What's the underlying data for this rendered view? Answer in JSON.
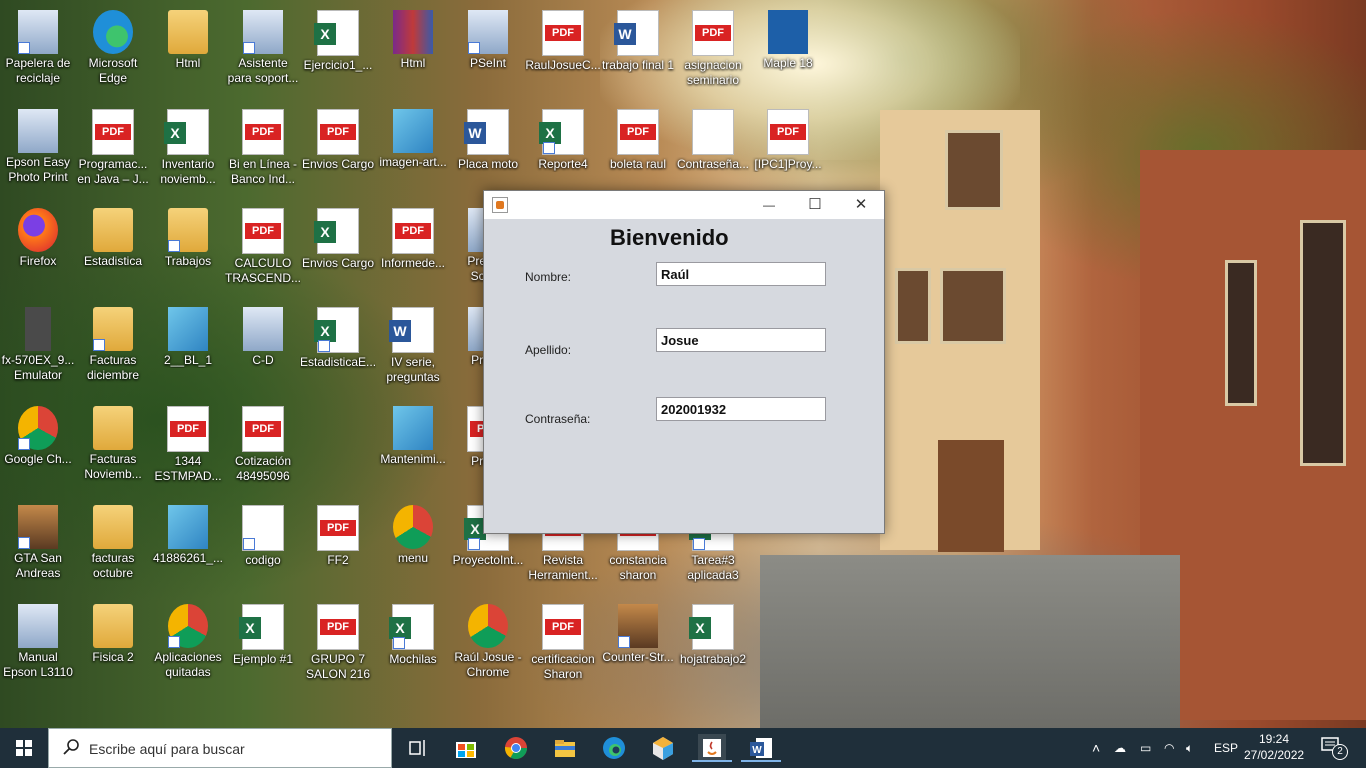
{
  "desktop_icons": [
    {
      "label": "Papelera de reciclaje",
      "type": "recycle-bin",
      "col": 0,
      "row": 0
    },
    {
      "label": "Microsoft Edge",
      "type": "edge",
      "col": 1,
      "row": 0
    },
    {
      "label": "Html",
      "type": "folder",
      "col": 2,
      "row": 0
    },
    {
      "label": "Asistente para soport...",
      "type": "app",
      "col": 3,
      "row": 0
    },
    {
      "label": "Ejercicio1_...",
      "type": "xls",
      "col": 4,
      "row": 0
    },
    {
      "label": "Html",
      "type": "winrar",
      "col": 5,
      "row": 0
    },
    {
      "label": "PSeInt",
      "type": "app",
      "col": 6,
      "row": 0
    },
    {
      "label": "RaulJosueC...",
      "type": "pdf",
      "col": 7,
      "row": 0
    },
    {
      "label": "trabajo final 1",
      "type": "doc",
      "col": 8,
      "row": 0
    },
    {
      "label": "asignacion seminario",
      "type": "pdf",
      "col": 9,
      "row": 0
    },
    {
      "label": "Maple 18",
      "type": "maple",
      "col": 10,
      "row": 0
    },
    {
      "label": "Epson Easy Photo Print",
      "type": "app",
      "col": 0,
      "row": 1
    },
    {
      "label": "Programac... en Java – J...",
      "type": "pdf",
      "col": 1,
      "row": 1
    },
    {
      "label": "Inventario noviemb...",
      "type": "xls",
      "col": 2,
      "row": 1
    },
    {
      "label": "Bi en Línea - Banco Ind...",
      "type": "pdf",
      "col": 3,
      "row": 1
    },
    {
      "label": "Envios Cargo",
      "type": "pdf",
      "col": 4,
      "row": 1
    },
    {
      "label": "imagen-art...",
      "type": "image",
      "col": 5,
      "row": 1
    },
    {
      "label": "Placa moto",
      "type": "doc",
      "col": 6,
      "row": 1
    },
    {
      "label": "Reporte4",
      "type": "xls",
      "col": 7,
      "row": 1
    },
    {
      "label": "boleta raul",
      "type": "pdf",
      "col": 8,
      "row": 1
    },
    {
      "label": "Contraseña...",
      "type": "txt",
      "col": 9,
      "row": 1
    },
    {
      "label": "[IPC1]Proy...",
      "type": "pdf",
      "col": 10,
      "row": 1
    },
    {
      "label": "Firefox",
      "type": "firefox",
      "col": 0,
      "row": 2
    },
    {
      "label": "Estadistica",
      "type": "folder",
      "col": 1,
      "row": 2
    },
    {
      "label": "Trabajos",
      "type": "folder",
      "col": 2,
      "row": 2
    },
    {
      "label": "CALCULO TRASCEND...",
      "type": "pdf",
      "col": 3,
      "row": 2
    },
    {
      "label": "Envios Cargo",
      "type": "xls",
      "col": 4,
      "row": 2
    },
    {
      "label": "Informede...",
      "type": "pdf",
      "col": 5,
      "row": 2
    },
    {
      "label": "Prese... Scre...",
      "type": "app",
      "col": 6,
      "row": 2
    },
    {
      "label": "fx-570EX_9... Emulator",
      "type": "calc",
      "col": 0,
      "row": 3
    },
    {
      "label": "Facturas diciembre",
      "type": "folder",
      "col": 1,
      "row": 3
    },
    {
      "label": "2__BL_1",
      "type": "image",
      "col": 2,
      "row": 3
    },
    {
      "label": "C-D",
      "type": "app",
      "col": 3,
      "row": 3
    },
    {
      "label": "EstadisticaE...",
      "type": "xls",
      "col": 4,
      "row": 3
    },
    {
      "label": "IV serie, preguntas",
      "type": "doc",
      "col": 5,
      "row": 3
    },
    {
      "label": "Proy...",
      "type": "app",
      "col": 6,
      "row": 3
    },
    {
      "label": "Google Ch...",
      "type": "chrome",
      "col": 0,
      "row": 4
    },
    {
      "label": "Facturas Noviemb...",
      "type": "folder",
      "col": 1,
      "row": 4
    },
    {
      "label": "1344 ESTMPAD...",
      "type": "pdf",
      "col": 2,
      "row": 4
    },
    {
      "label": "Cotización 48495096",
      "type": "pdf",
      "col": 3,
      "row": 4
    },
    {
      "label": "Mantenimi...",
      "type": "image",
      "col": 5,
      "row": 4
    },
    {
      "label": "Proy...",
      "type": "pdf",
      "col": 6,
      "row": 4
    },
    {
      "label": "GTA San Andreas",
      "type": "game",
      "col": 0,
      "row": 5
    },
    {
      "label": "facturas octubre",
      "type": "folder",
      "col": 1,
      "row": 5
    },
    {
      "label": "41886261_...",
      "type": "image",
      "col": 2,
      "row": 5
    },
    {
      "label": "codigo",
      "type": "txt",
      "col": 3,
      "row": 5
    },
    {
      "label": "FF2",
      "type": "pdf",
      "col": 4,
      "row": 5
    },
    {
      "label": "menu",
      "type": "chrome",
      "col": 5,
      "row": 5
    },
    {
      "label": "ProyectoInt...",
      "type": "xls",
      "col": 6,
      "row": 5
    },
    {
      "label": "Revista Herramient...",
      "type": "pdf",
      "col": 7,
      "row": 5
    },
    {
      "label": "constancia sharon",
      "type": "pdf",
      "col": 8,
      "row": 5
    },
    {
      "label": "Tarea#3 aplicada3",
      "type": "xls",
      "col": 9,
      "row": 5
    },
    {
      "label": "Manual Epson L3110",
      "type": "app",
      "col": 0,
      "row": 6
    },
    {
      "label": "Fisica 2",
      "type": "folder",
      "col": 1,
      "row": 6
    },
    {
      "label": "Aplicaciones quitadas",
      "type": "chrome",
      "col": 2,
      "row": 6
    },
    {
      "label": "Ejemplo #1",
      "type": "xls",
      "col": 3,
      "row": 6
    },
    {
      "label": "GRUPO 7 SALON 216",
      "type": "pdf",
      "col": 4,
      "row": 6
    },
    {
      "label": "Mochilas",
      "type": "xls",
      "col": 5,
      "row": 6
    },
    {
      "label": "Raúl Josue - Chrome",
      "type": "chrome",
      "col": 6,
      "row": 6
    },
    {
      "label": "certificacion Sharon",
      "type": "pdf",
      "col": 7,
      "row": 6
    },
    {
      "label": "Counter-Str...",
      "type": "game",
      "col": 8,
      "row": 6
    },
    {
      "label": "hojatrabajo2",
      "type": "xls",
      "col": 9,
      "row": 6
    }
  ],
  "window": {
    "title": "",
    "minimize": "—",
    "maximize": "☐",
    "close": "✕",
    "heading": "Bienvenido",
    "fields": {
      "nombre_label": "Nombre:",
      "nombre_value": "Raúl",
      "apellido_label": "Apellido:",
      "apellido_value": "Josue",
      "password_label": "Contraseña:",
      "password_value": "202001932"
    }
  },
  "taskbar": {
    "search_placeholder": "Escribe aquí para buscar",
    "language": "ESP",
    "time": "19:24",
    "date": "27/02/2022",
    "notifications_count": "2"
  }
}
